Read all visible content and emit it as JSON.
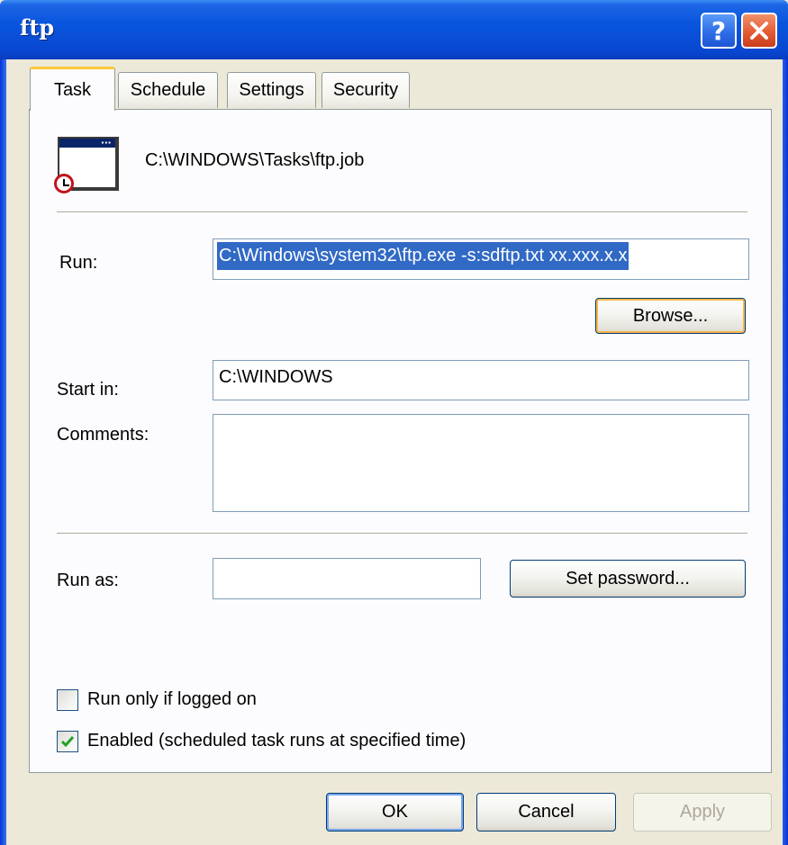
{
  "window": {
    "title": "ftp",
    "help_glyph": "?",
    "close_glyph": "✕"
  },
  "tabs": [
    {
      "label": "Task",
      "active": true
    },
    {
      "label": "Schedule",
      "active": false
    },
    {
      "label": "Settings",
      "active": false
    },
    {
      "label": "Security",
      "active": false
    }
  ],
  "task": {
    "job_path": "C:\\WINDOWS\\Tasks\\ftp.job",
    "run_label": "Run:",
    "run_value": "C:\\Windows\\system32\\ftp.exe  -s:sdftp.txt   xx.xxx.x.x",
    "browse_label": "Browse...",
    "start_in_label": "Start in:",
    "start_in_value": "C:\\WINDOWS",
    "comments_label": "Comments:",
    "comments_value": "",
    "run_as_label": "Run as:",
    "run_as_value": "",
    "set_password_label": "Set password...",
    "run_only_if_logged_on": {
      "label": "Run only if logged on",
      "checked": false
    },
    "enabled": {
      "label": "Enabled (scheduled task runs at specified time)",
      "checked": true
    }
  },
  "footer": {
    "ok_label": "OK",
    "cancel_label": "Cancel",
    "apply_label": "Apply"
  }
}
